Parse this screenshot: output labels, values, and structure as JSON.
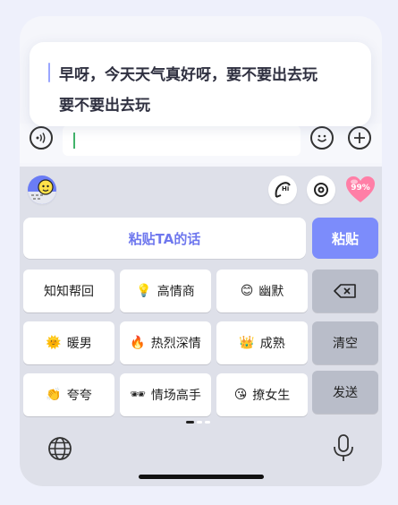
{
  "message": {
    "line1": "早呀，今天天气真好呀，要不要出去玩",
    "line2": "要不要出去玩"
  },
  "toolbar": {
    "battery_label": "99%"
  },
  "paste": {
    "prompt": "粘贴TA的话",
    "button": "粘贴"
  },
  "keys": [
    {
      "label": "知知帮回",
      "emoji": ""
    },
    {
      "label": "高情商",
      "emoji": "💡"
    },
    {
      "label": "幽默",
      "emoji": "😊"
    },
    {
      "label": "暖男",
      "emoji": "🌞"
    },
    {
      "label": "热烈深情",
      "emoji": "🔥"
    },
    {
      "label": "成熟",
      "emoji": "👑"
    },
    {
      "label": "夸夸",
      "emoji": "👏"
    },
    {
      "label": "情场高手",
      "emoji": "🕶"
    },
    {
      "label": "撩女生",
      "emoji": "😘"
    }
  ],
  "side_keys": {
    "clear": "清空",
    "send": "发送"
  },
  "icons": {
    "voice": "voice-icon",
    "emoji": "emoji-icon",
    "add": "add-icon",
    "globe": "globe-icon",
    "mic": "microphone-icon",
    "hi": "hi-bubble-icon",
    "target": "target-icon",
    "heart": "heart-icon",
    "avatar": "avatar-icon"
  },
  "colors": {
    "accent": "#7c8cfb",
    "accent_text": "#6f78ee",
    "keyboard_bg": "#dee0e9",
    "heart": "#ff7ea6"
  }
}
